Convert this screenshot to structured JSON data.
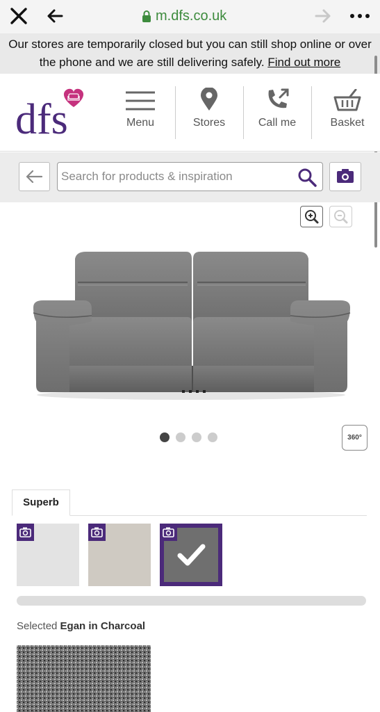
{
  "browser": {
    "url": "m.dfs.co.uk"
  },
  "banner": {
    "text": "Our stores are temporarily closed but you can still shop online or over the phone and we are still delivering safely.",
    "link": "Find out more"
  },
  "header": {
    "logo_text": "dfs",
    "brand_color": "#4b2a7a",
    "heart_color": "#c5327e",
    "nav": [
      {
        "label": "Menu",
        "icon": "menu-icon"
      },
      {
        "label": "Stores",
        "icon": "map-pin-icon"
      },
      {
        "label": "Call me",
        "icon": "phone-icon"
      },
      {
        "label": "Basket",
        "icon": "basket-icon"
      }
    ]
  },
  "search": {
    "placeholder": "Search for products & inspiration"
  },
  "gallery": {
    "total_images": 4,
    "active_index": 0,
    "view_360_label": "360°"
  },
  "fabric": {
    "tab_label": "Superb",
    "swatches": [
      {
        "name": "swatch-light",
        "selected": false
      },
      {
        "name": "swatch-natural",
        "selected": false
      },
      {
        "name": "swatch-charcoal",
        "selected": true
      }
    ],
    "selected_prefix": "Selected",
    "selected_name": "Egan in Charcoal"
  }
}
